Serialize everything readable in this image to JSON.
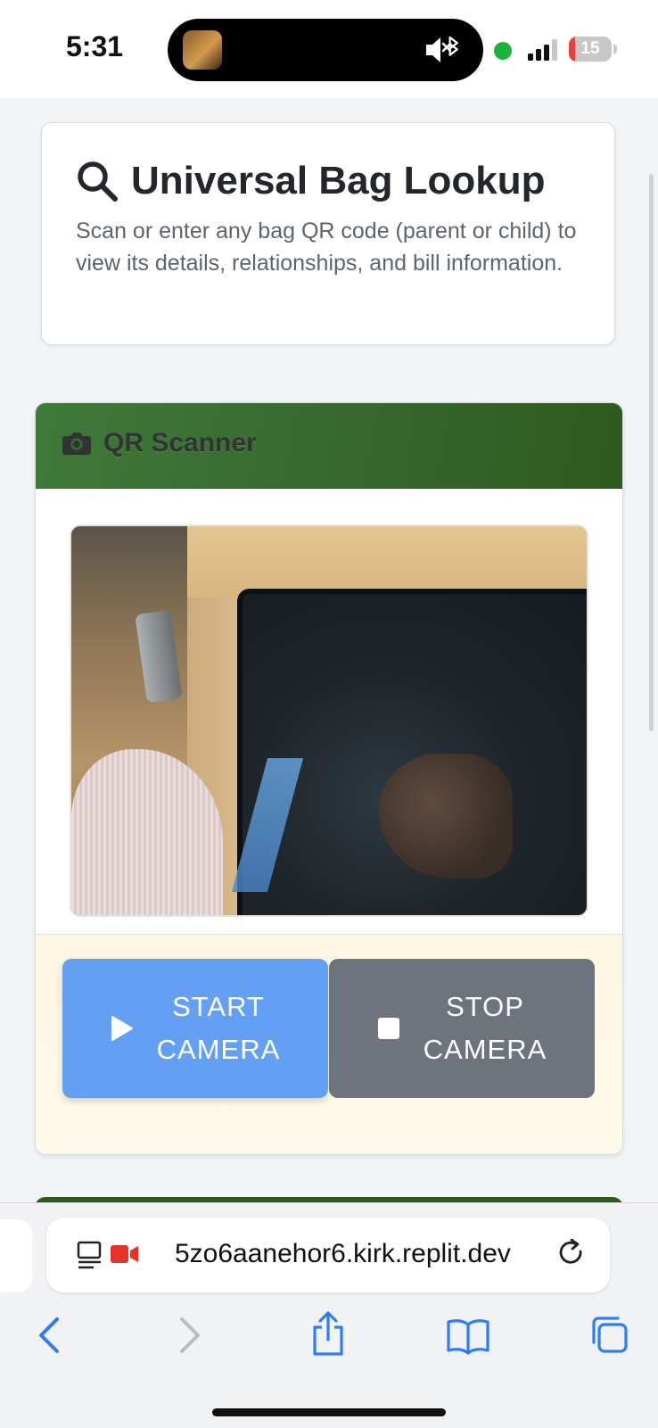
{
  "status_bar": {
    "time": "5:31",
    "battery_level": "15",
    "battery_fraction": 0.15,
    "icons": [
      "now-playing-thumbnail",
      "mute-icon",
      "bluetooth-icon",
      "camera-in-use-dot",
      "signal-icon",
      "battery-icon"
    ]
  },
  "header": {
    "title": "Universal Bag Lookup",
    "description": "Scan or enter any bag QR code (parent or child) to view its details, relationships, and bill information.",
    "icon": "search-icon"
  },
  "scanner": {
    "title": "QR Scanner",
    "icon": "camera-icon",
    "start_label": "START\nCAMERA",
    "stop_label": "STOP\nCAMERA",
    "start_icon": "play-icon",
    "stop_icon": "stop-icon"
  },
  "browser": {
    "url": "5zo6aanehor6.kirk.replit.dev",
    "icons": [
      "reader-icon",
      "camera-recording-icon",
      "reload-icon",
      "back-icon",
      "forward-icon",
      "share-icon",
      "bookmarks-icon",
      "tabs-icon"
    ]
  },
  "colors": {
    "scanner_header": "#37672f",
    "start_button": "#63a0f4",
    "stop_button": "#6d747b",
    "controls_bg": "#fdf6e2",
    "ios_blue": "#2f7cf6"
  }
}
